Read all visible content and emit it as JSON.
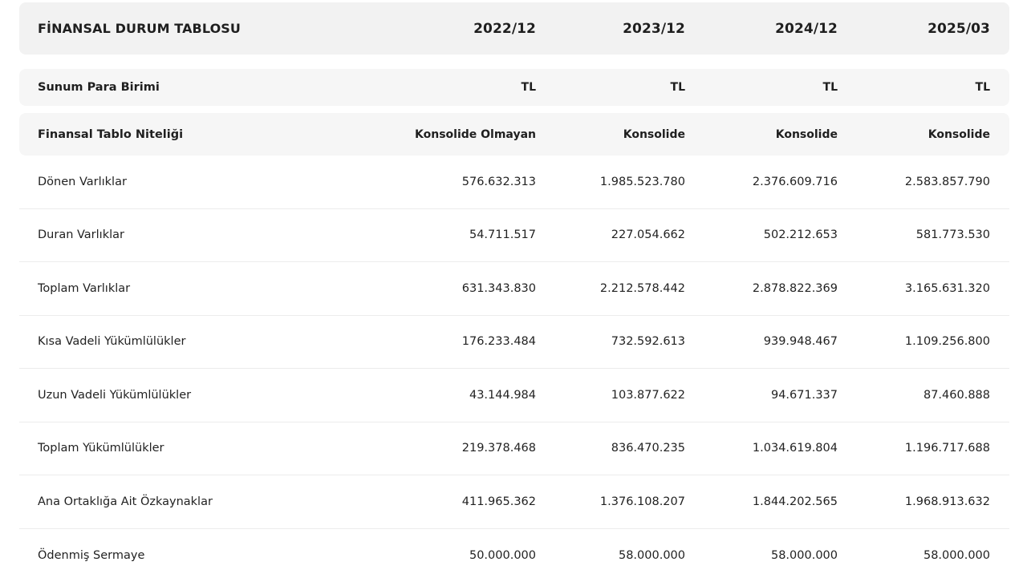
{
  "header": {
    "title": "FİNANSAL DURUM TABLOSU",
    "periods": [
      "2022/12",
      "2023/12",
      "2024/12",
      "2025/03"
    ]
  },
  "meta_rows": [
    {
      "label": "Sunum Para Birimi",
      "values": [
        "TL",
        "TL",
        "TL",
        "TL"
      ]
    },
    {
      "label": "Finansal Tablo Niteliği",
      "values": [
        "Konsolide Olmayan",
        "Konsolide",
        "Konsolide",
        "Konsolide"
      ]
    }
  ],
  "rows": [
    {
      "label": "Dönen Varlıklar",
      "values": [
        "576.632.313",
        "1.985.523.780",
        "2.376.609.716",
        "2.583.857.790"
      ]
    },
    {
      "label": "Duran Varlıklar",
      "values": [
        "54.711.517",
        "227.054.662",
        "502.212.653",
        "581.773.530"
      ]
    },
    {
      "label": "Toplam Varlıklar",
      "values": [
        "631.343.830",
        "2.212.578.442",
        "2.878.822.369",
        "3.165.631.320"
      ]
    },
    {
      "label": "Kısa Vadeli Yükümlülükler",
      "values": [
        "176.233.484",
        "732.592.613",
        "939.948.467",
        "1.109.256.800"
      ]
    },
    {
      "label": "Uzun Vadeli Yükümlülükler",
      "values": [
        "43.144.984",
        "103.877.622",
        "94.671.337",
        "87.460.888"
      ]
    },
    {
      "label": "Toplam Yükümlülükler",
      "values": [
        "219.378.468",
        "836.470.235",
        "1.034.619.804",
        "1.196.717.688"
      ]
    },
    {
      "label": "Ana Ortaklığa Ait Özkaynaklar",
      "values": [
        "411.965.362",
        "1.376.108.207",
        "1.844.202.565",
        "1.968.913.632"
      ]
    },
    {
      "label": "Ödenmiş Sermaye",
      "values": [
        "50.000.000",
        "58.000.000",
        "58.000.000",
        "58.000.000"
      ]
    }
  ]
}
